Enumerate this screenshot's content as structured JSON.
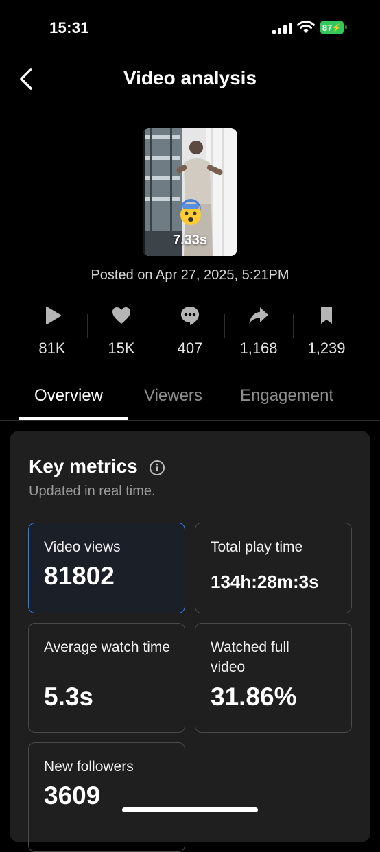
{
  "status_bar": {
    "time": "15:31",
    "battery": "87"
  },
  "header": {
    "title": "Video analysis"
  },
  "video": {
    "duration": "7.33s",
    "posted": "Posted on Apr 27, 2025, 5:21PM"
  },
  "stats": [
    {
      "icon": "play-icon",
      "value": "81K"
    },
    {
      "icon": "heart-icon",
      "value": "15K"
    },
    {
      "icon": "comment-icon",
      "value": "407"
    },
    {
      "icon": "share-icon",
      "value": "1,168"
    },
    {
      "icon": "bookmark-icon",
      "value": "1,239"
    }
  ],
  "tabs": [
    {
      "label": "Overview",
      "active": true
    },
    {
      "label": "Viewers",
      "active": false
    },
    {
      "label": "Engagement",
      "active": false
    }
  ],
  "key_metrics": {
    "title": "Key metrics",
    "subtitle": "Updated in real time.",
    "metrics": [
      {
        "label": "Video views",
        "value": "81802"
      },
      {
        "label": "Total play time",
        "value": "134h:28m:3s"
      },
      {
        "label": "Average watch time",
        "value": "5.3s"
      },
      {
        "label": "Watched full video",
        "value": "31.86%"
      },
      {
        "label": "New followers",
        "value": "3609"
      }
    ]
  },
  "colors": {
    "accent_blue": "#2f7dff",
    "battery_green": "#34c759",
    "background": "#000000",
    "card": "#1f1f1f"
  }
}
